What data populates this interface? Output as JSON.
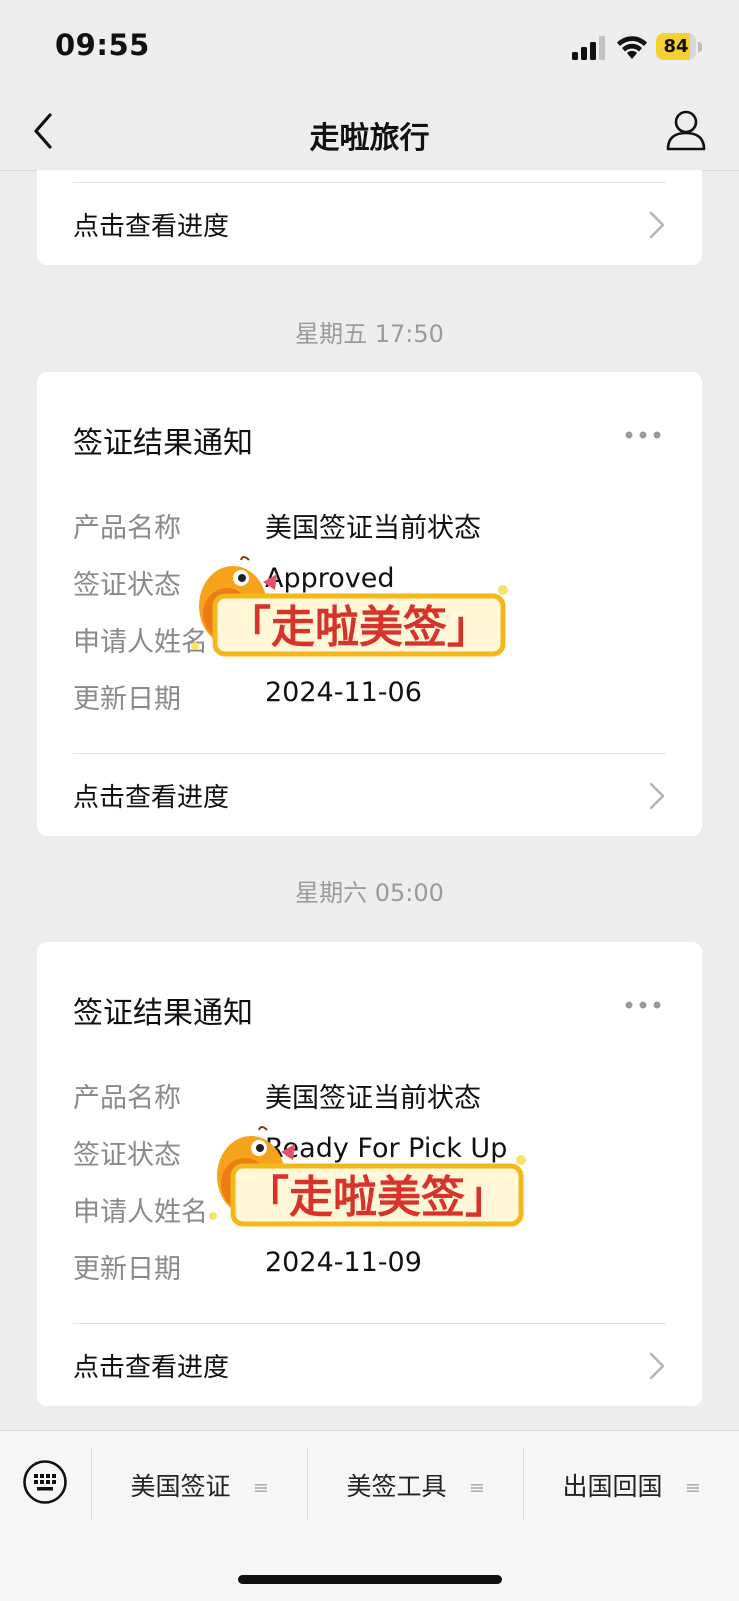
{
  "status_bar": {
    "time": "09:55",
    "battery": "84"
  },
  "nav": {
    "title": "走啦旅行"
  },
  "first_card": {
    "progress_label": "点击查看进度"
  },
  "messages": [
    {
      "timestamp": "星期五 17:50",
      "title": "签证结果通知",
      "fields": [
        {
          "label": "产品名称",
          "value": "美国签证当前状态"
        },
        {
          "label": "签证状态",
          "value": "Approved"
        },
        {
          "label": "申请人姓名",
          "value": ""
        },
        {
          "label": "更新日期",
          "value": "2024-11-06"
        }
      ],
      "progress_label": "点击查看进度",
      "watermark": "「走啦美签」"
    },
    {
      "timestamp": "星期六 05:00",
      "title": "签证结果通知",
      "fields": [
        {
          "label": "产品名称",
          "value": "美国签证当前状态"
        },
        {
          "label": "签证状态",
          "value": "Ready For Pick Up"
        },
        {
          "label": "申请人姓名",
          "value": ""
        },
        {
          "label": "更新日期",
          "value": "2024-11-09"
        }
      ],
      "progress_label": "点击查看进度",
      "watermark": "「走啦美签」"
    }
  ],
  "bottom_menu": {
    "items": [
      {
        "label": "美国签证",
        "icon": "menu-lines-icon"
      },
      {
        "label": "美签工具",
        "icon": "menu-lines-icon"
      },
      {
        "label": "出国回国",
        "icon": "menu-lines-icon"
      }
    ]
  },
  "colors": {
    "background": "#ededed",
    "card": "#ffffff",
    "battery": "#f4d12d"
  }
}
